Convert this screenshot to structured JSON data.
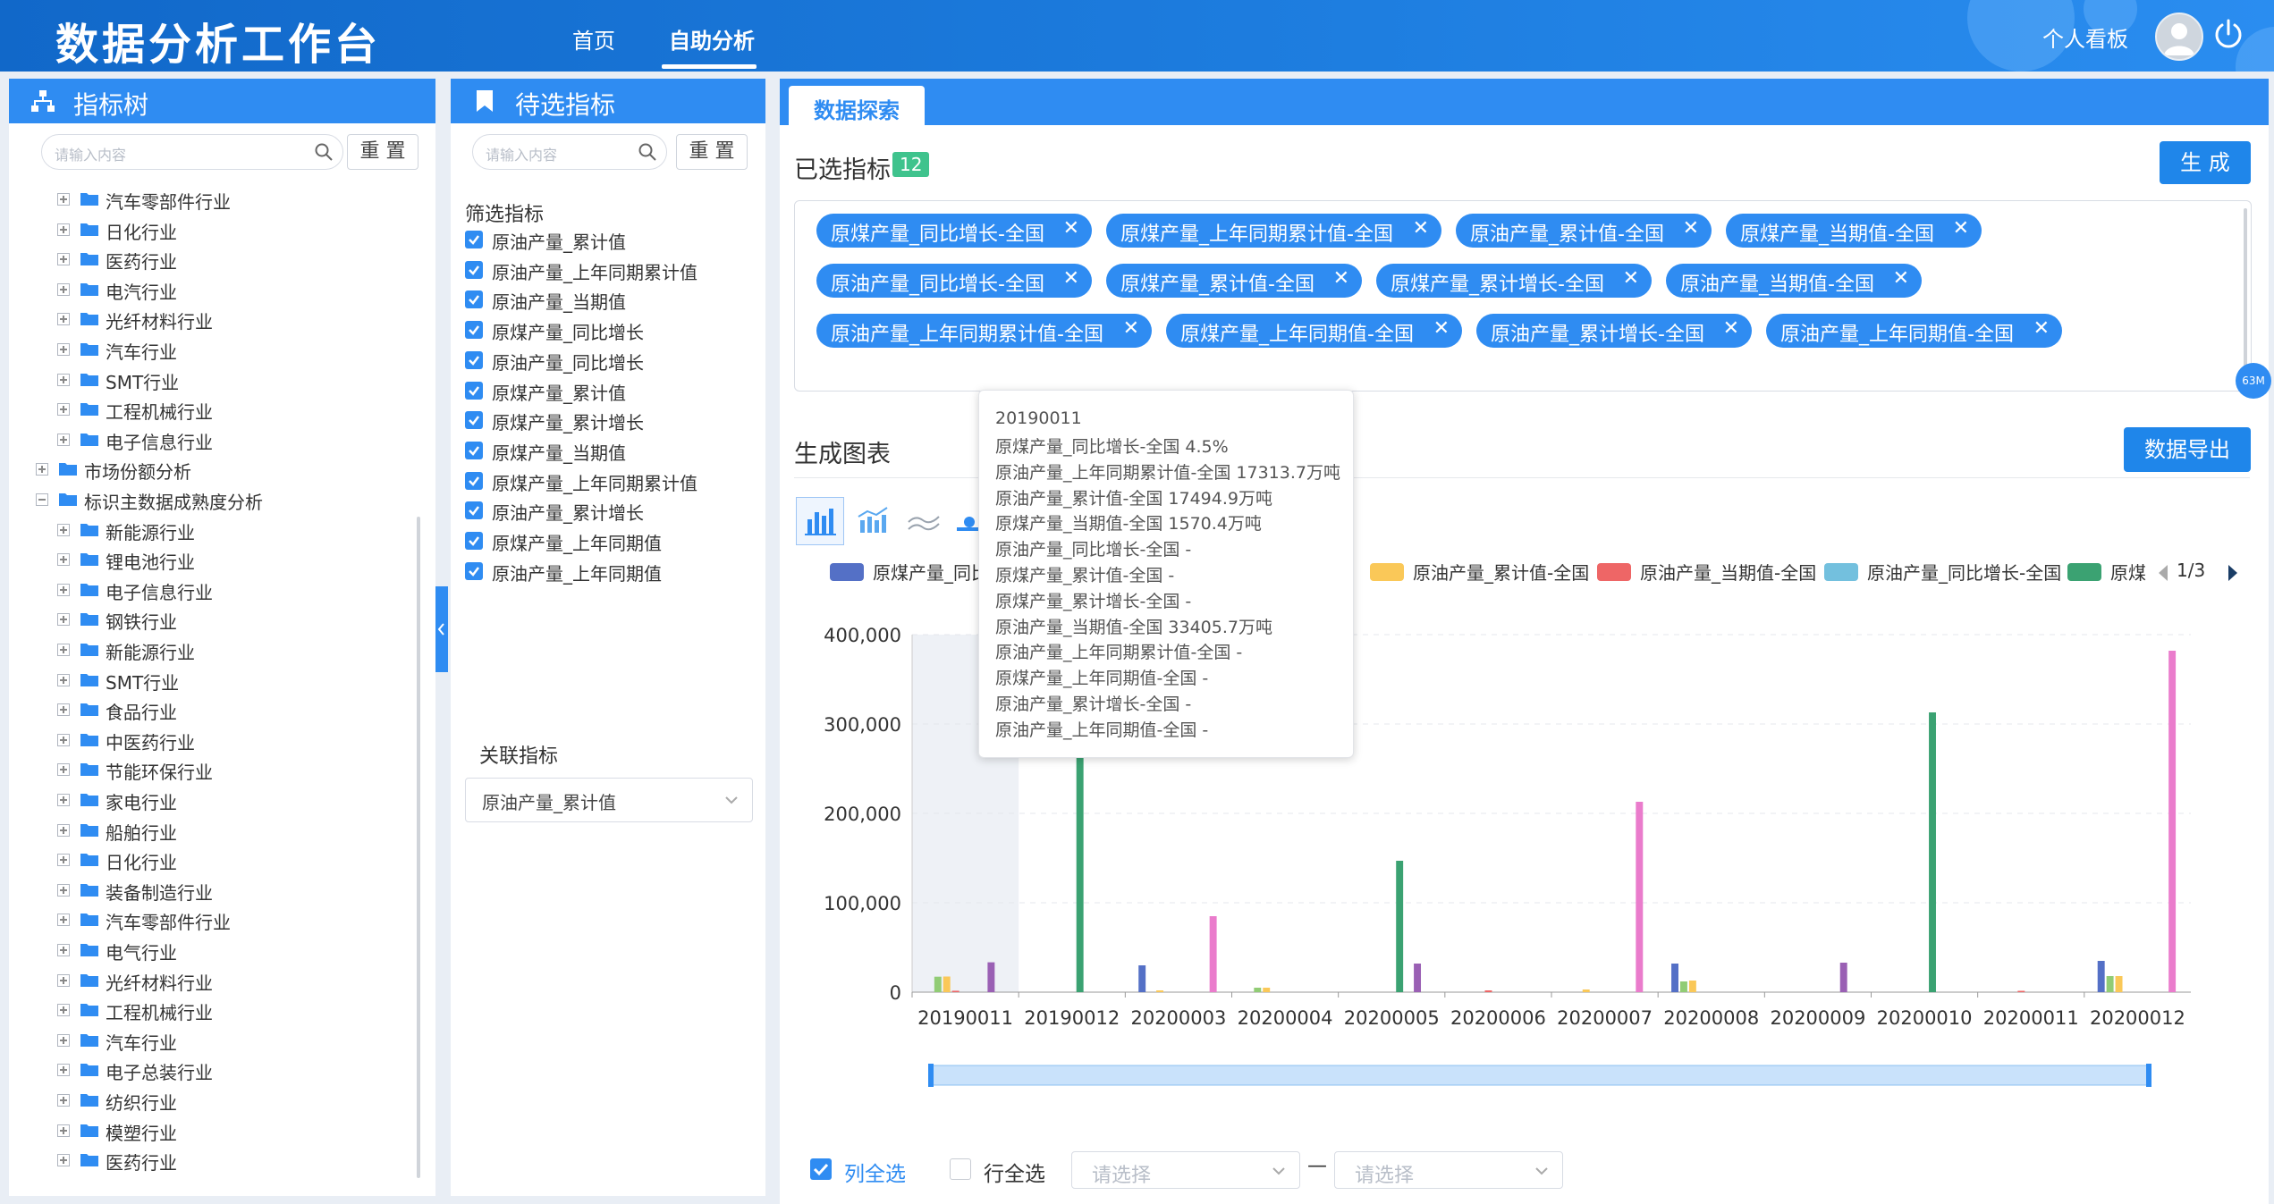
{
  "app": {
    "title": "数据分析工作台",
    "nav": [
      {
        "label": "首页",
        "active": false
      },
      {
        "label": "自助分析",
        "active": true
      }
    ],
    "personal_board": "个人看板"
  },
  "tree_panel": {
    "title": "指标树",
    "search_placeholder": "请输入内容",
    "reset_label": "重 置",
    "items": [
      {
        "label": "汽车零部件行业",
        "level": 2,
        "expand": "plus"
      },
      {
        "label": "日化行业",
        "level": 2,
        "expand": "plus"
      },
      {
        "label": "医药行业",
        "level": 2,
        "expand": "plus"
      },
      {
        "label": "电汽行业",
        "level": 2,
        "expand": "plus"
      },
      {
        "label": "光纤材料行业",
        "level": 2,
        "expand": "plus"
      },
      {
        "label": "汽车行业",
        "level": 2,
        "expand": "plus"
      },
      {
        "label": "SMT行业",
        "level": 2,
        "expand": "plus"
      },
      {
        "label": "工程机械行业",
        "level": 2,
        "expand": "plus"
      },
      {
        "label": "电子信息行业",
        "level": 2,
        "expand": "plus"
      },
      {
        "label": "市场份额分析",
        "level": 1,
        "expand": "plus"
      },
      {
        "label": "标识主数据成熟度分析",
        "level": 1,
        "expand": "minus"
      },
      {
        "label": "新能源行业",
        "level": 2,
        "expand": "plus"
      },
      {
        "label": "锂电池行业",
        "level": 2,
        "expand": "plus"
      },
      {
        "label": "电子信息行业",
        "level": 2,
        "expand": "plus"
      },
      {
        "label": "钢铁行业",
        "level": 2,
        "expand": "plus"
      },
      {
        "label": "新能源行业",
        "level": 2,
        "expand": "plus"
      },
      {
        "label": "SMT行业",
        "level": 2,
        "expand": "plus"
      },
      {
        "label": "食品行业",
        "level": 2,
        "expand": "plus"
      },
      {
        "label": "中医药行业",
        "level": 2,
        "expand": "plus"
      },
      {
        "label": "节能环保行业",
        "level": 2,
        "expand": "plus"
      },
      {
        "label": "家电行业",
        "level": 2,
        "expand": "plus"
      },
      {
        "label": "船舶行业",
        "level": 2,
        "expand": "plus"
      },
      {
        "label": "日化行业",
        "level": 2,
        "expand": "plus"
      },
      {
        "label": "装备制造行业",
        "level": 2,
        "expand": "plus"
      },
      {
        "label": "汽车零部件行业",
        "level": 2,
        "expand": "plus"
      },
      {
        "label": "电气行业",
        "level": 2,
        "expand": "plus"
      },
      {
        "label": "光纤材料行业",
        "level": 2,
        "expand": "plus"
      },
      {
        "label": "工程机械行业",
        "level": 2,
        "expand": "plus"
      },
      {
        "label": "汽车行业",
        "level": 2,
        "expand": "plus"
      },
      {
        "label": "电子总装行业",
        "level": 2,
        "expand": "plus"
      },
      {
        "label": "纺织行业",
        "level": 2,
        "expand": "plus"
      },
      {
        "label": "模塑行业",
        "level": 2,
        "expand": "plus"
      },
      {
        "label": "医药行业",
        "level": 2,
        "expand": "plus"
      }
    ]
  },
  "candidate_panel": {
    "title": "待选指标",
    "search_placeholder": "请输入内容",
    "reset_label": "重 置",
    "filter_title": "筛选指标",
    "filters": [
      "原油产量_累计值",
      "原油产量_上年同期累计值",
      "原油产量_当期值",
      "原煤产量_同比增长",
      "原油产量_同比增长",
      "原煤产量_累计值",
      "原煤产量_累计增长",
      "原煤产量_当期值",
      "原煤产量_上年同期累计值",
      "原油产量_累计增长",
      "原煤产量_上年同期值",
      "原油产量_上年同期值"
    ],
    "related_title": "关联指标",
    "related_value": "原油产量_累计值"
  },
  "explore": {
    "tab": "数据探索",
    "selected_title": "已选指标",
    "selected_count": "12",
    "generate_label": "生 成",
    "side_badge": "63M",
    "tags": [
      "原煤产量_同比增长-全国",
      "原煤产量_上年同期累计值-全国",
      "原油产量_累计值-全国",
      "原煤产量_当期值-全国",
      "原油产量_同比增长-全国",
      "原煤产量_累计值-全国",
      "原煤产量_累计增长-全国",
      "原油产量_当期值-全国",
      "原油产量_上年同期累计值-全国",
      "原煤产量_上年同期值-全国",
      "原油产量_累计增长-全国",
      "原油产量_上年同期值-全国"
    ],
    "chart_title": "生成图表",
    "export_label": "数据导出",
    "legend_page": "1/3",
    "bottom": {
      "col_all": "列全选",
      "row_all": "行全选",
      "select_placeholder_1": "请选择",
      "dash": "—",
      "select_placeholder_2": "请选择"
    }
  },
  "tooltip": {
    "title": "20190011",
    "lines": [
      "原煤产量_同比增长-全国 4.5%",
      "原油产量_上年同期累计值-全国 17313.7万吨",
      "原油产量_累计值-全国 17494.9万吨",
      "原煤产量_当期值-全国 1570.4万吨",
      "原油产量_同比增长-全国 -",
      "原煤产量_累计值-全国 -",
      "原煤产量_累计增长-全国 -",
      "原油产量_当期值-全国 33405.7万吨",
      "原油产量_上年同期累计值-全国 -",
      "原煤产量_上年同期值-全国 -",
      "原油产量_累计增长-全国 -",
      "原油产量_上年同期值-全国 -"
    ]
  },
  "chart_data": {
    "type": "bar",
    "categories": [
      "20190011",
      "20190012",
      "20200003",
      "20200004",
      "20200005",
      "20200006",
      "20200007",
      "20200008",
      "20200009",
      "20200010",
      "20200011",
      "20200012"
    ],
    "ylim": [
      0,
      400000
    ],
    "yticks": [
      "0",
      "100,000",
      "200,000",
      "300,000",
      "400,000"
    ],
    "ytick_values": [
      0,
      100000,
      200000,
      300000,
      400000
    ],
    "legend": [
      {
        "name": "原煤产量_同比",
        "color": "#5470c6"
      },
      {
        "name": "原油产量_累计值-全国",
        "color": "#fac858"
      },
      {
        "name": "原油产量_当期值-全国",
        "color": "#ee6666"
      },
      {
        "name": "原油产量_同比增长-全国",
        "color": "#73c0de"
      },
      {
        "name": "原煤",
        "color": "#3ba272"
      }
    ],
    "series": [
      {
        "name": "原煤产量_同比增长-全国",
        "color": "#5470c6",
        "values": [
          0,
          0,
          30000,
          0,
          0,
          0,
          0,
          32000,
          0,
          0,
          0,
          35000
        ]
      },
      {
        "name": "原油产量_上年同期累计值-全国",
        "color": "#91cc75",
        "values": [
          17314,
          0,
          0,
          5000,
          0,
          0,
          0,
          12000,
          0,
          0,
          0,
          18000
        ]
      },
      {
        "name": "原油产量_累计值-全国",
        "color": "#fac858",
        "values": [
          17495,
          0,
          2000,
          5000,
          0,
          0,
          3000,
          13000,
          0,
          0,
          0,
          18000
        ]
      },
      {
        "name": "原煤产量_当期值-全国",
        "color": "#ee6666",
        "values": [
          1570,
          0,
          0,
          0,
          0,
          2000,
          0,
          0,
          0,
          0,
          1500,
          0
        ]
      },
      {
        "name": "原油产量_同比增长-全国",
        "color": "#73c0de",
        "values": [
          0,
          0,
          0,
          0,
          0,
          0,
          0,
          0,
          0,
          0,
          0,
          0
        ]
      },
      {
        "name": "原煤产量_累计值-全国",
        "color": "#3ba272",
        "values": [
          0,
          270000,
          0,
          0,
          147000,
          0,
          0,
          0,
          0,
          313000,
          0,
          0
        ]
      },
      {
        "name": "原煤产量_累计增长-全国",
        "color": "#fc8452",
        "values": [
          0,
          0,
          0,
          0,
          0,
          0,
          0,
          0,
          0,
          0,
          0,
          0
        ]
      },
      {
        "name": "原油产量_当期值-全国",
        "color": "#9a60b4",
        "values": [
          33406,
          0,
          0,
          0,
          32000,
          0,
          0,
          0,
          33000,
          0,
          0,
          0
        ]
      },
      {
        "name": "原油产量_上年同期累计值-全国",
        "color": "#ea7ccc",
        "values": [
          0,
          0,
          85000,
          0,
          0,
          0,
          213000,
          0,
          0,
          0,
          0,
          382000
        ]
      }
    ]
  }
}
